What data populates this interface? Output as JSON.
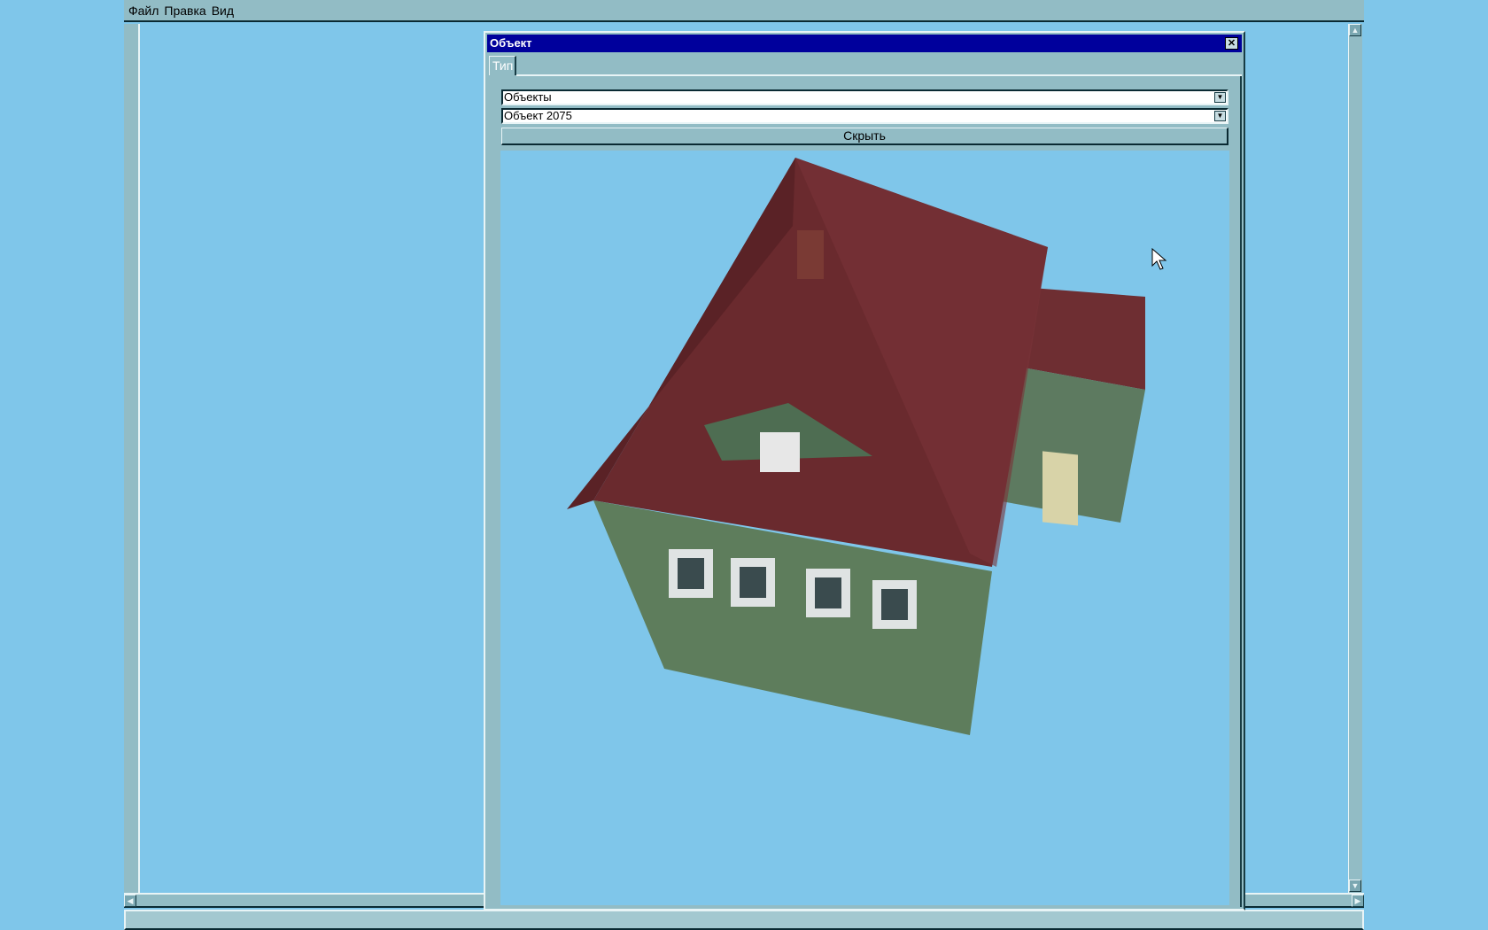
{
  "menu": {
    "items": [
      "Файл",
      "Правка",
      "Вид"
    ]
  },
  "dialog": {
    "title": "Объект",
    "close_icon": "close-icon",
    "tabs": [
      {
        "label": "Тип",
        "active": true
      }
    ],
    "category_select": {
      "value": "Объекты"
    },
    "object_select": {
      "value": "Объект 2075"
    },
    "hide_button": "Скрыть"
  },
  "colors": {
    "background": "#7fc6ea",
    "titlebar": "#00009c",
    "panel": "#92bcc5"
  }
}
